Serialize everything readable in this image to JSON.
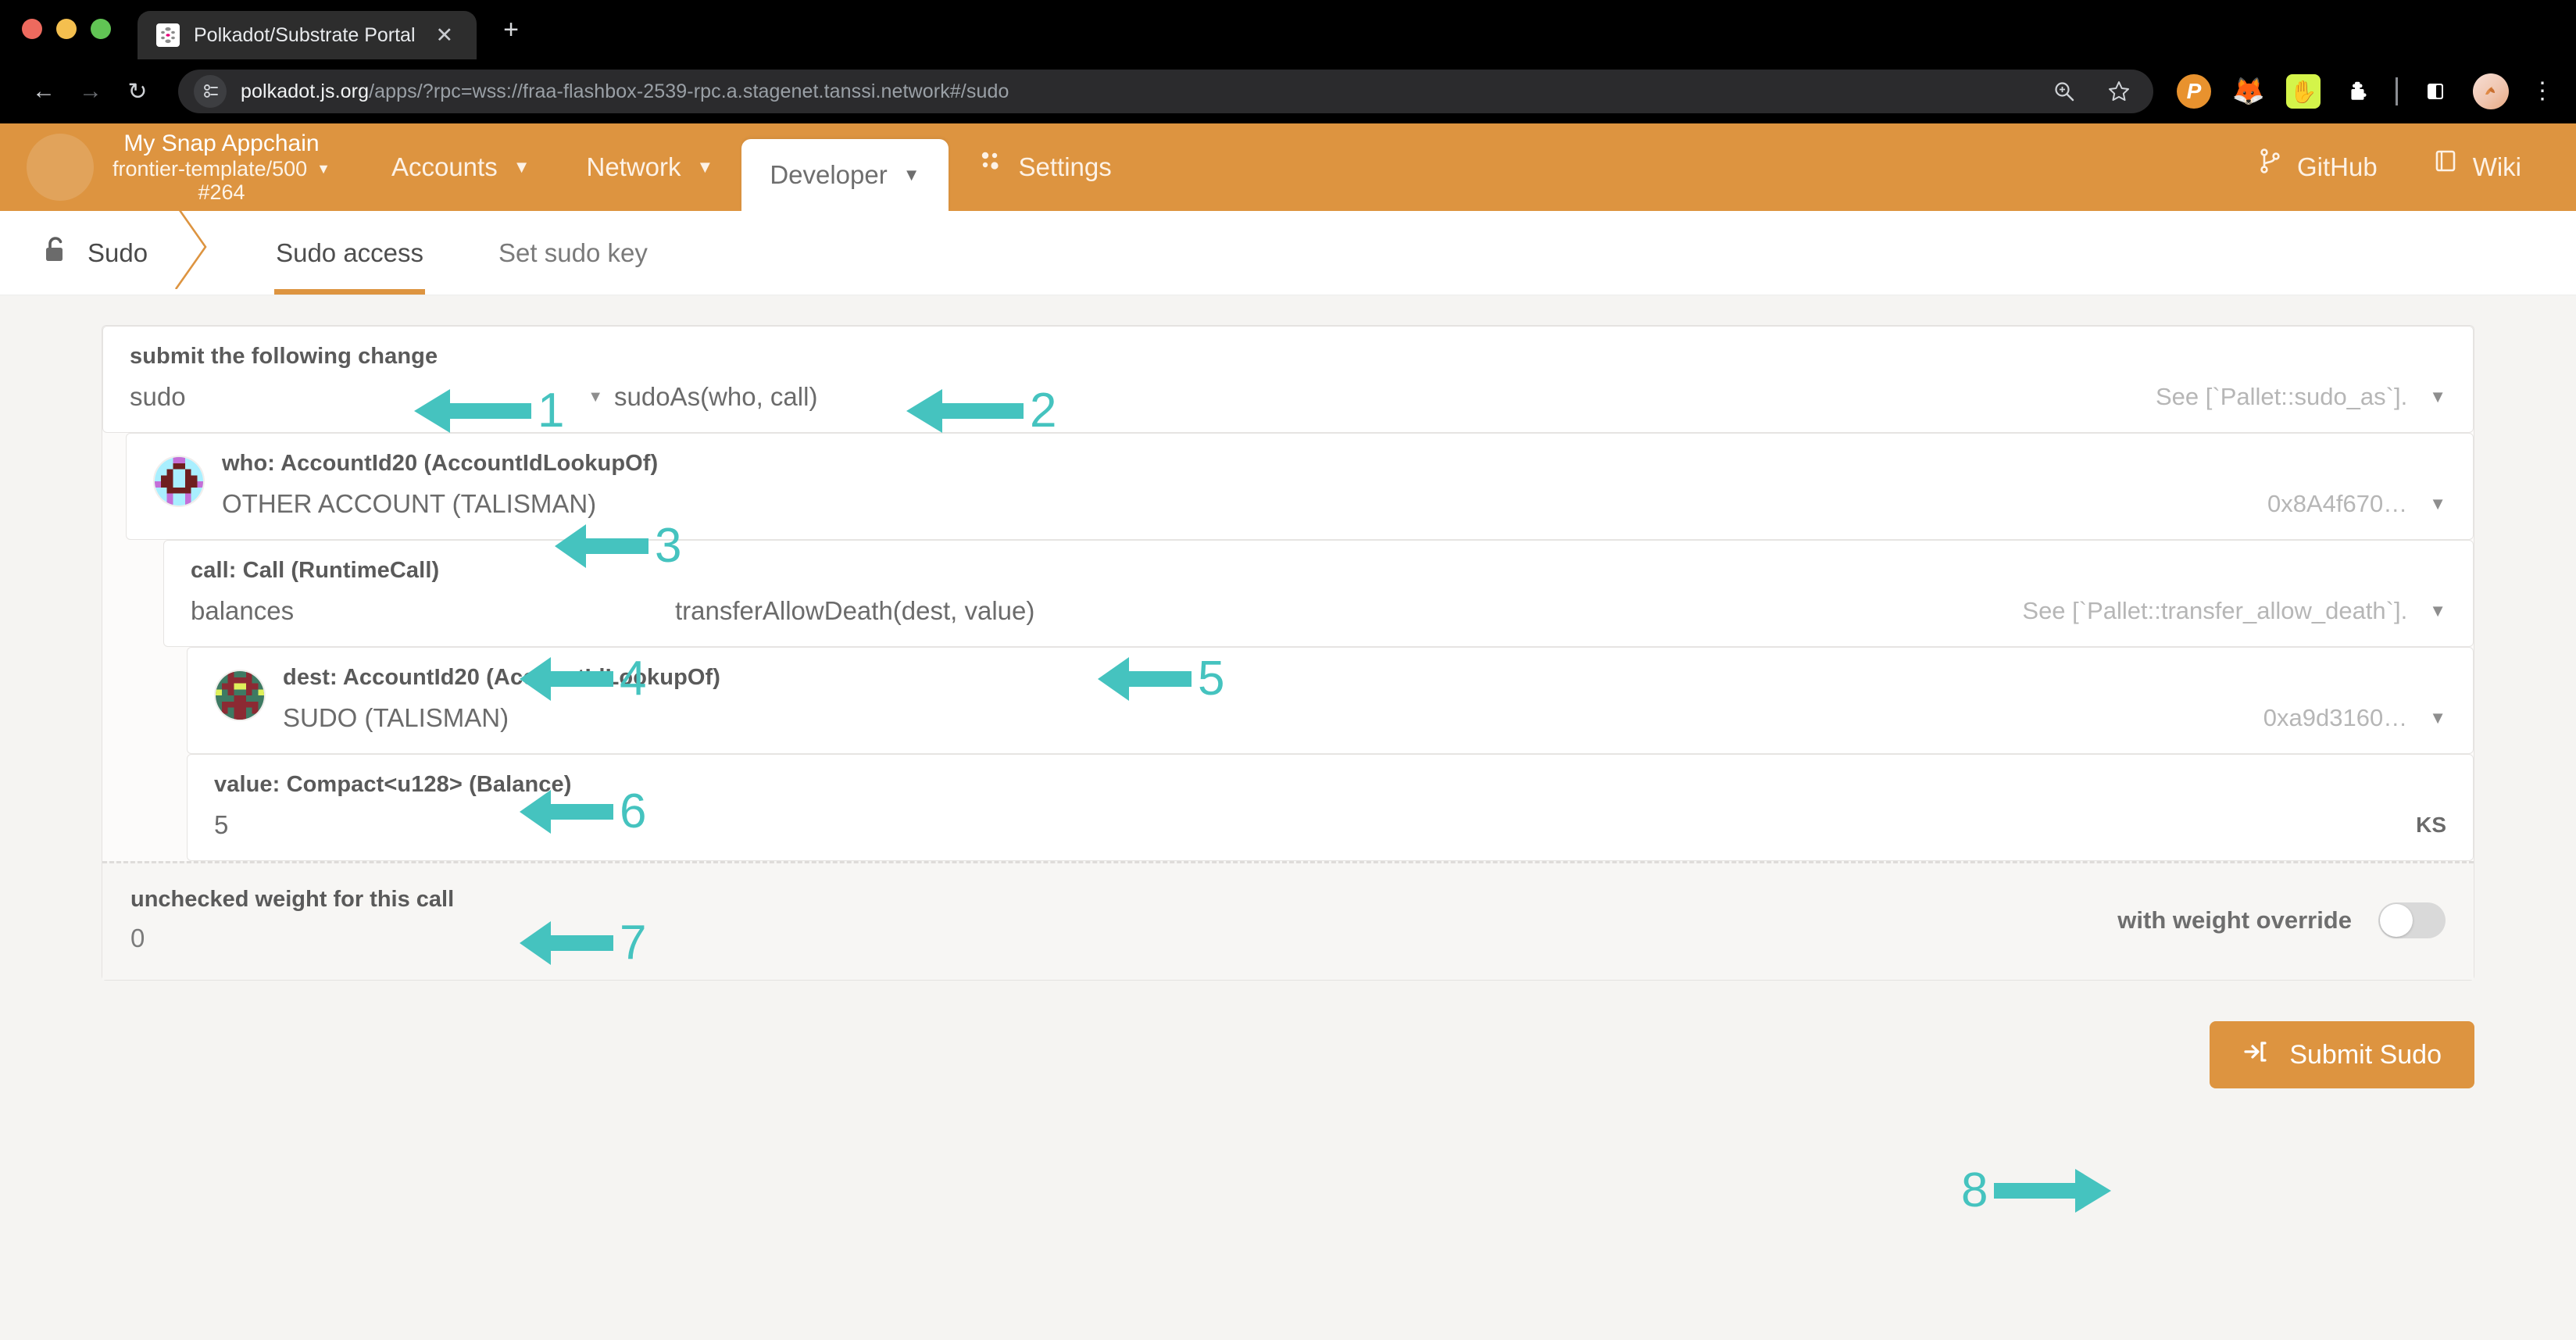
{
  "browser": {
    "tab_title": "Polkadot/Substrate Portal",
    "tab_close": "✕",
    "new_tab": "+",
    "back": "←",
    "forward": "→",
    "reload": "↻",
    "url_host": "polkadot.js.org",
    "url_rest": "/apps/?rpc=wss://fraa-flashbox-2539-rpc.a.stagenet.tanssi.network#/sudo",
    "zoom_icon": "⊕",
    "bookmark_icon": "☆",
    "ext_polkadot": "P",
    "ext_metamask": "🦊",
    "ext_talisman": "✋",
    "ext_puzzle": "⬟",
    "side_panel": "◧",
    "profile": "🦊",
    "kebab": "⋮"
  },
  "app_header": {
    "chain_name": "My Snap Appchain",
    "chain_spec": "frontier-template/500",
    "chain_block": "#264",
    "nav": [
      {
        "label": "Accounts",
        "has_caret": true,
        "active": false
      },
      {
        "label": "Network",
        "has_caret": true,
        "active": false
      },
      {
        "label": "Developer",
        "has_caret": true,
        "active": true
      },
      {
        "label": "Settings",
        "has_caret": false,
        "active": false
      }
    ],
    "settings_icon": "⚙",
    "right": [
      {
        "label": "GitHub",
        "icon": "git-icon"
      },
      {
        "label": "Wiki",
        "icon": "book-icon"
      }
    ],
    "caret": "▼",
    "accent_color": "#dd9440"
  },
  "subnav": {
    "breadcrumb": "Sudo",
    "lock_icon": "unlock-icon",
    "tabs": [
      {
        "label": "Sudo access",
        "active": true
      },
      {
        "label": "Set sudo key",
        "active": false
      }
    ]
  },
  "form": {
    "submit_change": {
      "label": "submit the following change",
      "pallet": "sudo",
      "method": "sudoAs(who, call)",
      "docs": "See [`Pallet::sudo_as`].",
      "caret": "▼"
    },
    "who": {
      "label": "who: AccountId20 (AccountIdLookupOf)",
      "value": "OTHER ACCOUNT (TALISMAN)",
      "address": "0x8A4f670…",
      "caret": "▼"
    },
    "call": {
      "label": "call: Call (RuntimeCall)",
      "pallet": "balances",
      "method": "transferAllowDeath(dest, value)",
      "docs": "See [`Pallet::transfer_allow_death`].",
      "caret": "▼"
    },
    "dest": {
      "label": "dest: AccountId20 (AccountIdLookupOf)",
      "value": "SUDO (TALISMAN)",
      "address": "0xa9d3160…",
      "caret": "▼"
    },
    "value": {
      "label": "value: Compact<u128> (Balance)",
      "amount": "5",
      "unit": "KS"
    },
    "weight": {
      "label": "unchecked weight for this call",
      "amount": "0",
      "override_label": "with weight override",
      "override_on": false
    },
    "submit_button": {
      "label": "Submit Sudo",
      "icon": "login-icon"
    }
  },
  "annotations": {
    "color": "#45c3bf",
    "markers": [
      {
        "id": "1",
        "target": "pallet-select-sudo",
        "dir": "left"
      },
      {
        "id": "2",
        "target": "method-select-sudoas",
        "dir": "left"
      },
      {
        "id": "3",
        "target": "who-account-value",
        "dir": "left"
      },
      {
        "id": "4",
        "target": "call-pallet-balances",
        "dir": "left"
      },
      {
        "id": "5",
        "target": "call-method-transfer",
        "dir": "left"
      },
      {
        "id": "6",
        "target": "dest-account-value",
        "dir": "left"
      },
      {
        "id": "7",
        "target": "value-amount",
        "dir": "left"
      },
      {
        "id": "8",
        "target": "submit-sudo-button",
        "dir": "right"
      }
    ]
  }
}
